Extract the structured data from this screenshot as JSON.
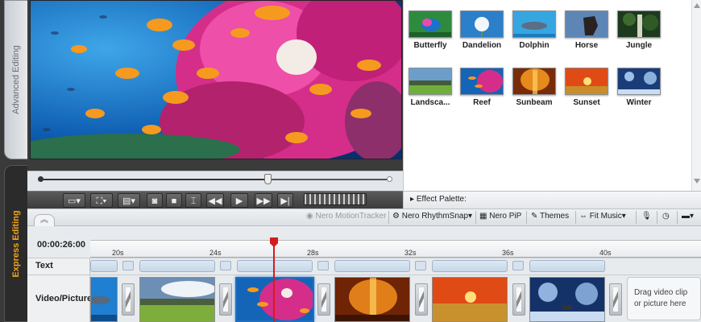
{
  "sidebar": {
    "advanced_tab": "Advanced Editing",
    "express_tab": "Express Editing"
  },
  "library": {
    "themes": [
      {
        "label": "Butterfly",
        "icon": "butterfly-thumbnail"
      },
      {
        "label": "Dandelion",
        "icon": "dandelion-thumbnail"
      },
      {
        "label": "Dolphin",
        "icon": "dolphin-thumbnail"
      },
      {
        "label": "Horse",
        "icon": "horse-thumbnail"
      },
      {
        "label": "Jungle",
        "icon": "jungle-thumbnail"
      },
      {
        "label": "Landsca...",
        "icon": "landscape-thumbnail"
      },
      {
        "label": "Reef",
        "icon": "reef-thumbnail"
      },
      {
        "label": "Sunbeam",
        "icon": "sunbeam-thumbnail"
      },
      {
        "label": "Sunset",
        "icon": "sunset-thumbnail"
      },
      {
        "label": "Winter",
        "icon": "winter-thumbnail"
      }
    ]
  },
  "player": {
    "scrub_position": 0.65
  },
  "effect_palette": {
    "label": "Effect Palette:"
  },
  "toolbar": {
    "motion_tracker": "Nero MotionTracker",
    "rhythm_snap": "Nero RhythmSnap",
    "pip": "Nero PiP",
    "themes": "Themes",
    "fit_music": "Fit Music"
  },
  "timeline": {
    "timecode": "00:00:26:00",
    "ticks": [
      "20s",
      "24s",
      "28s",
      "32s",
      "36s",
      "40s"
    ],
    "text_track_label": "Text",
    "video_track_label": "Video/Picture",
    "drop_hint": "Drag video clip or picture here"
  },
  "colors": {
    "accent_orange": "#f2a41a",
    "playhead_red": "#d41c1c",
    "selection_blue": "#1f6fbf"
  }
}
